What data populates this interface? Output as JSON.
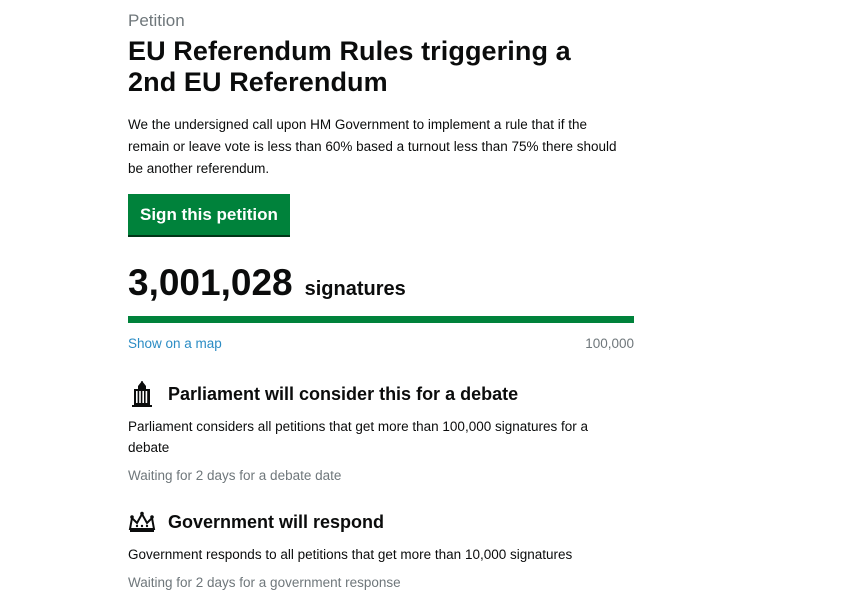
{
  "petition": {
    "eyebrow": "Petition",
    "title_line1": "EU Referendum Rules triggering a",
    "title_line2": "2nd EU Referendum",
    "description": "We the undersigned call upon HM Government to implement a rule that if the remain or leave vote is less than 60% based a turnout less than 75% there should be another referendum.",
    "sign_button_label": "Sign this petition"
  },
  "signatures": {
    "count": "3,001,028",
    "label": "signatures",
    "progress_fraction": 1.0,
    "map_link_label": "Show on a map",
    "threshold": "100,000"
  },
  "debate": {
    "heading": "Parliament will consider this for a debate",
    "text": "Parliament considers all petitions that get more than 100,000 signatures for a debate",
    "status": "Waiting for 2 days for a debate date",
    "icon": "parliament-icon"
  },
  "response": {
    "heading": "Government will respond",
    "text": "Government responds to all petitions that get more than 10,000 signatures",
    "status": "Waiting for 2 days for a government response",
    "icon": "crown-icon"
  },
  "colors": {
    "accent_green": "#00823b",
    "link_blue": "#2b8cc4",
    "secondary_text": "#6f777b"
  }
}
